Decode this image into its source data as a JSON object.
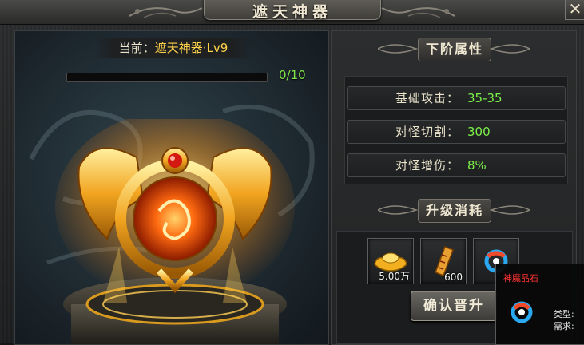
{
  "window": {
    "title": "遮天神器",
    "close_icon": "close-icon",
    "close_glyph": "✕"
  },
  "preview": {
    "current_prefix": "当前：",
    "current_name": "遮天神器·Lv9",
    "progress_text": "0/10",
    "progress_fraction": 0.0
  },
  "next_tier": {
    "header": "下阶属性",
    "attributes": [
      {
        "name": "基础攻击：",
        "value": "35-35"
      },
      {
        "name": "对怪切割：",
        "value": "300"
      },
      {
        "name": "对怪增伤：",
        "value": "8%"
      }
    ]
  },
  "upgrade_cost": {
    "header": "升级消耗",
    "items": [
      {
        "icon": "gold-ingot-icon",
        "count": "5.00万"
      },
      {
        "icon": "talisman-scroll-icon",
        "count": "600"
      },
      {
        "icon": "demon-crystal-icon",
        "count": ""
      }
    ],
    "confirm_label": "确认晋升"
  },
  "tooltip": {
    "title": "神魔晶石",
    "type_label": "类型:",
    "require_label": "需求:"
  },
  "colors": {
    "accent_green": "#7cf048",
    "name_gold": "#ffd24a",
    "tooltip_red": "#ff3232"
  }
}
